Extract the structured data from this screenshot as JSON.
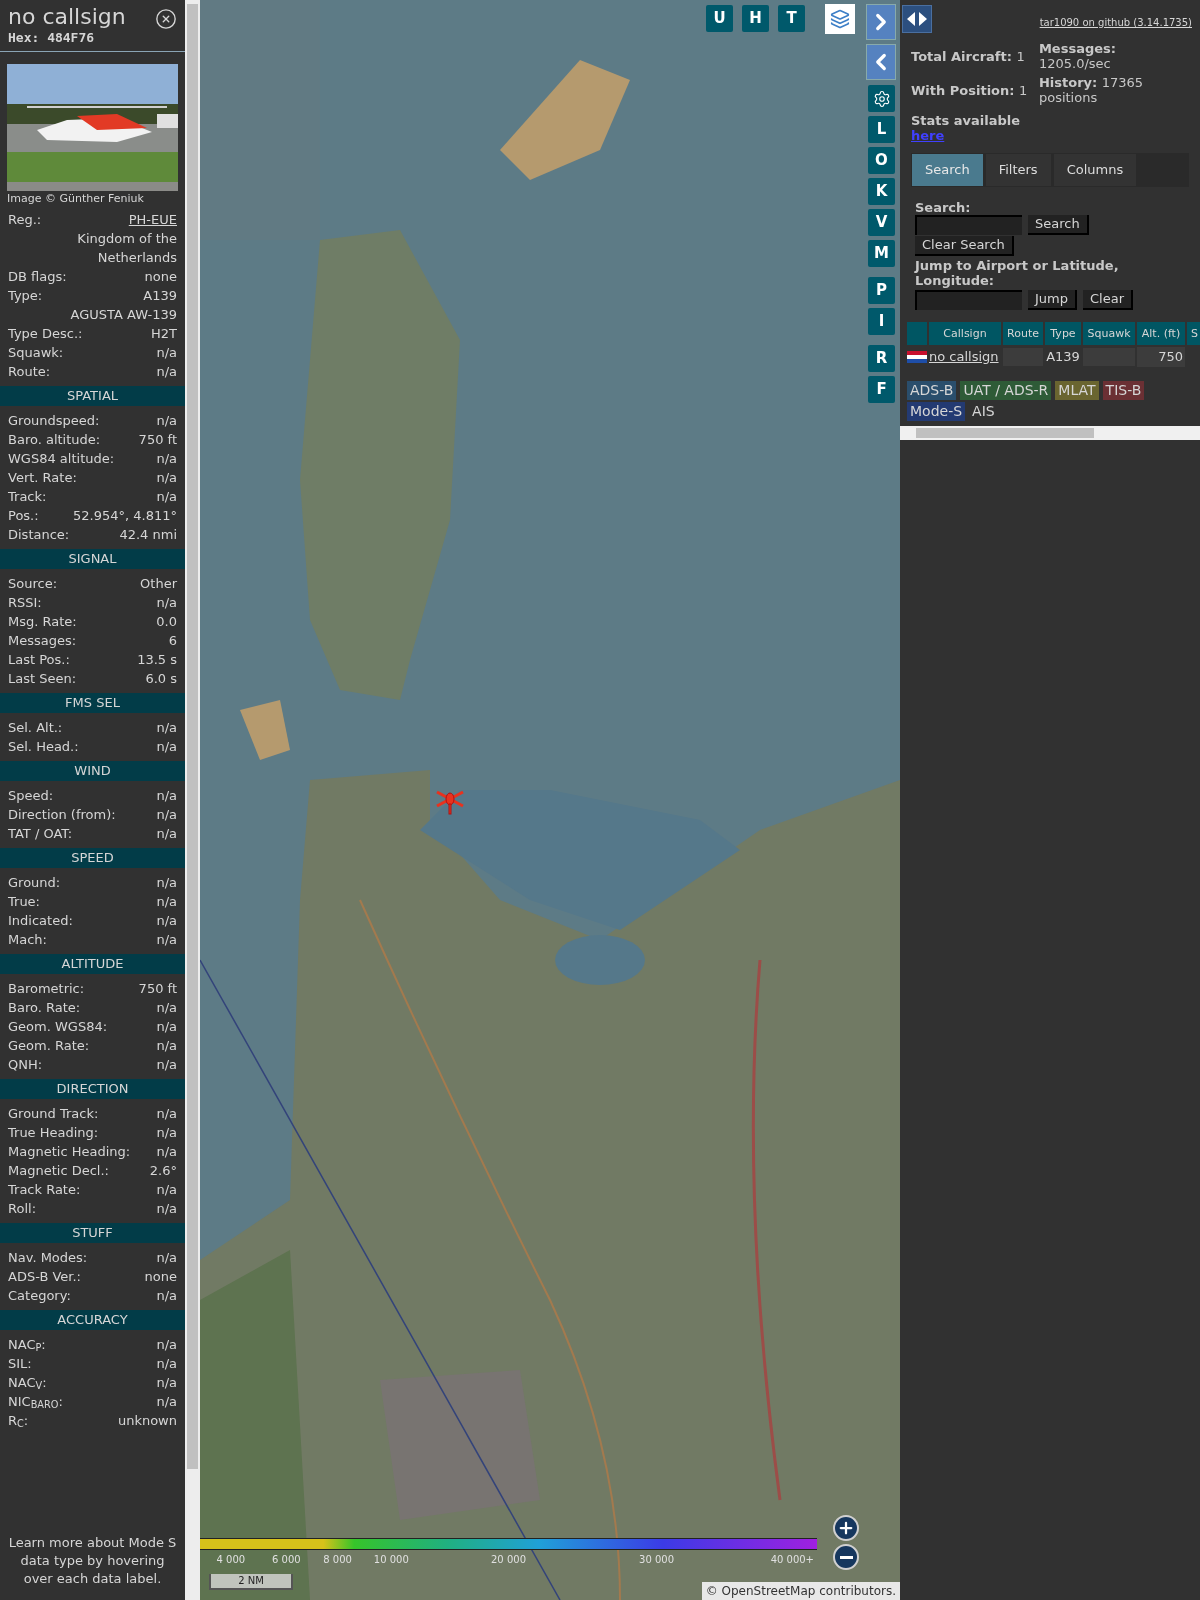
{
  "sidebar": {
    "title": "no callsign",
    "hex": "Hex: 484F76",
    "photo_credit": "Image © Günther Feniuk",
    "info_rows": [
      {
        "label": "Reg.:",
        "value": "PH-EUE",
        "kind": "link"
      },
      {
        "value": "Kingdom of the Netherlands",
        "kind": "plain"
      },
      {
        "label": "DB flags:",
        "value": "none",
        "kind": "plain"
      },
      {
        "label": "Type:",
        "value": "A139",
        "kind": "plain"
      },
      {
        "value": "AGUSTA AW-139",
        "kind": "plain"
      },
      {
        "label": "Type Desc.:",
        "value": "H2T",
        "kind": "plain"
      },
      {
        "label": "Squawk:",
        "value": "n/a",
        "kind": "plain"
      },
      {
        "label": "Route:",
        "value": "n/a",
        "kind": "plain"
      }
    ],
    "sections": [
      {
        "title": "SPATIAL",
        "rows": [
          {
            "label": "Groundspeed:",
            "value": "n/a"
          },
          {
            "label": "Baro. altitude:",
            "value": "750 ft"
          },
          {
            "label": "WGS84 altitude:",
            "value": "n/a"
          },
          {
            "label": "Vert. Rate:",
            "value": "n/a"
          },
          {
            "label": "Track:",
            "value": "n/a"
          },
          {
            "label": "Pos.:",
            "value": "52.954°, 4.811°"
          },
          {
            "label": "Distance:",
            "value": "42.4 nmi"
          }
        ]
      },
      {
        "title": "SIGNAL",
        "rows": [
          {
            "label": "Source:",
            "value": "Other"
          },
          {
            "label": "RSSI:",
            "value": "n/a"
          },
          {
            "label": "Msg. Rate:",
            "value": "0.0"
          },
          {
            "label": "Messages:",
            "value": "6"
          },
          {
            "label": "Last Pos.:",
            "value": "13.5 s"
          },
          {
            "label": "Last Seen:",
            "value": "6.0 s"
          }
        ]
      },
      {
        "title": "FMS SEL",
        "rows": [
          {
            "label": "Sel. Alt.:",
            "value": "n/a"
          },
          {
            "label": "Sel. Head.:",
            "value": "n/a"
          }
        ]
      },
      {
        "title": "WIND",
        "rows": [
          {
            "label": "Speed:",
            "value": "n/a"
          },
          {
            "label": "Direction (from):",
            "value": "n/a"
          },
          {
            "label": "TAT / OAT:",
            "value": "n/a"
          }
        ]
      },
      {
        "title": "SPEED",
        "rows": [
          {
            "label": "Ground:",
            "value": "n/a"
          },
          {
            "label": "True:",
            "value": "n/a"
          },
          {
            "label": "Indicated:",
            "value": "n/a"
          },
          {
            "label": "Mach:",
            "value": "n/a"
          }
        ]
      },
      {
        "title": "ALTITUDE",
        "rows": [
          {
            "label": "Barometric:",
            "value": "750 ft"
          },
          {
            "label": "Baro. Rate:",
            "value": "n/a"
          },
          {
            "label": "Geom. WGS84:",
            "value": "n/a"
          },
          {
            "label": "Geom. Rate:",
            "value": "n/a"
          },
          {
            "label": "QNH:",
            "value": "n/a"
          }
        ]
      },
      {
        "title": "DIRECTION",
        "rows": [
          {
            "label": "Ground Track:",
            "value": "n/a"
          },
          {
            "label": "True Heading:",
            "value": "n/a"
          },
          {
            "label": "Magnetic Heading:",
            "value": "n/a"
          },
          {
            "label": "Magnetic Decl.:",
            "value": "2.6°"
          },
          {
            "label": "Track Rate:",
            "value": "n/a"
          },
          {
            "label": "Roll:",
            "value": "n/a"
          }
        ]
      },
      {
        "title": "STUFF",
        "rows": [
          {
            "label": "Nav. Modes:",
            "value": "n/a"
          },
          {
            "label": "ADS-B Ver.:",
            "value": "none"
          },
          {
            "label": "Category:",
            "value": "n/a"
          }
        ]
      },
      {
        "title": "ACCURACY",
        "rows": [
          {
            "label": "NAC$_{P}$:",
            "value": "n/a"
          },
          {
            "label": "SIL:",
            "value": "n/a"
          },
          {
            "label": "NAC$_{V}$:",
            "value": "n/a"
          },
          {
            "label": "NIC$_{BARO}$:",
            "value": "n/a"
          },
          {
            "label": "R$_{C}$:",
            "value": "unknown"
          }
        ]
      }
    ],
    "footer_note": "Learn more about Mode S data type by hovering over each data label."
  },
  "map": {
    "top_buttons": [
      "U",
      "H",
      "T"
    ],
    "side_buttons": [
      "L",
      "O",
      "K",
      "V",
      "M",
      "P",
      "I",
      "R",
      "F"
    ],
    "legend_ticks": [
      "4 000",
      "6 000",
      "8 000",
      "10 000",
      "20 000",
      "30 000",
      "40 000+"
    ],
    "scale": "2 NM",
    "attribution": "© OpenStreetMap contributors."
  },
  "panel": {
    "github_link": "tar1090 on github (3.14.1735)",
    "stats": [
      {
        "label": "Total Aircraft:",
        "value": "1"
      },
      {
        "label": "With Position:",
        "value": "1"
      }
    ],
    "messages": {
      "label": "Messages:",
      "value": "1205.0/sec"
    },
    "history": {
      "label": "History:",
      "value": "17365 positions"
    },
    "stats_available": "Stats available",
    "stats_link": "here",
    "tabs": [
      {
        "label": "Search",
        "selected": true
      },
      {
        "label": "Filters",
        "selected": false
      },
      {
        "label": "Columns",
        "selected": false
      }
    ],
    "search_label": "Search:",
    "search_button": "Search",
    "clear_search_button": "Clear Search",
    "jump_label": "Jump to Airport or Latitude, Longitude:",
    "jump_button": "Jump",
    "clear_button": "Clear",
    "table": {
      "columns": [
        "Callsign",
        "Route",
        "Type",
        "Squawk",
        "Alt. (ft)",
        "S"
      ],
      "rows": [
        {
          "callsign": "no callsign",
          "type": "A139",
          "altitude": "750"
        }
      ]
    },
    "sources": [
      {
        "label": "ADS-B",
        "color": "#2a4e6c"
      },
      {
        "label": "UAT / ADS-R",
        "color": "#2e5b37"
      },
      {
        "label": "MLAT",
        "color": "#6a6530"
      },
      {
        "label": "TIS-B",
        "color": "#6b3034"
      },
      {
        "label": "Mode-S",
        "color": "#233a72"
      },
      {
        "label": "AIS",
        "color": "#313131"
      }
    ]
  }
}
